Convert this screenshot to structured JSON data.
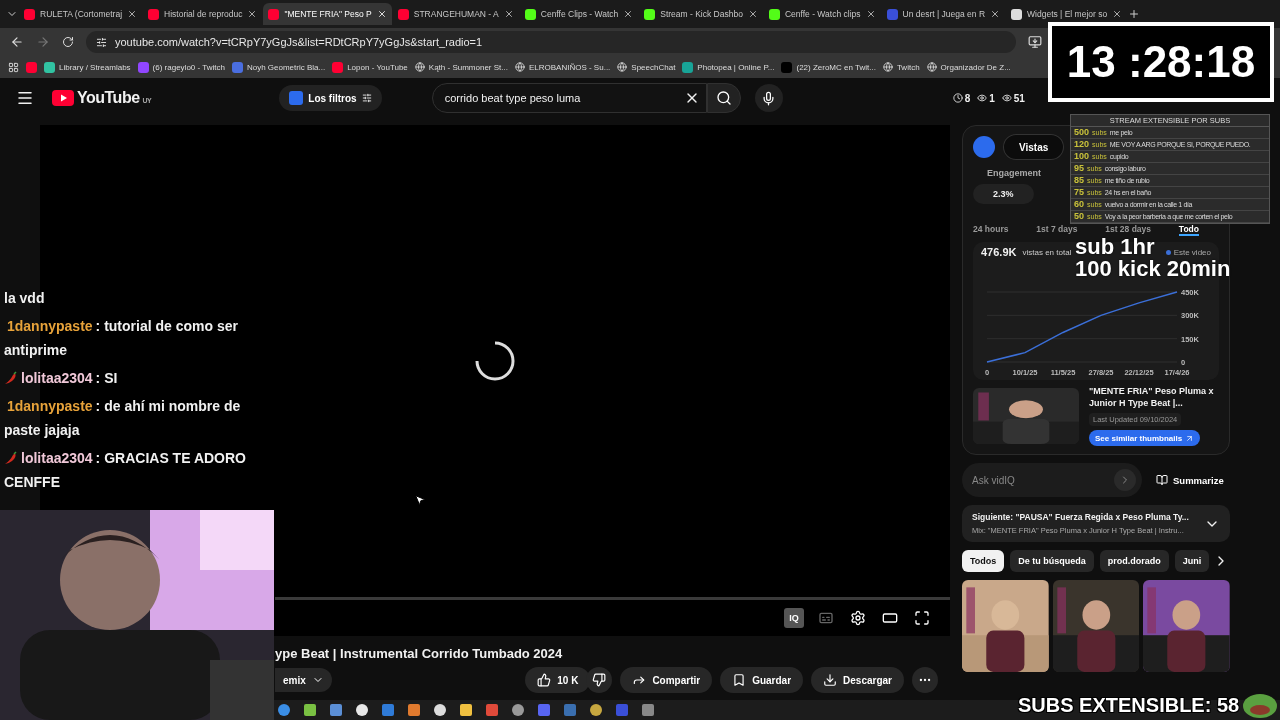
{
  "browser": {
    "tabs": [
      {
        "kind": "youtube",
        "title": "RULETA (Cortometraj",
        "selected": false
      },
      {
        "kind": "youtube",
        "title": "Historial de reproduc",
        "selected": false
      },
      {
        "kind": "youtube",
        "title": "\"MENTE FRIA\" Peso P",
        "selected": true
      },
      {
        "kind": "youtube",
        "title": "STRANGEHUMAN - A",
        "selected": false
      },
      {
        "kind": "kick",
        "title": "Cenffe Clips - Watch",
        "selected": false
      },
      {
        "kind": "kick",
        "title": "Stream - Kick Dashbo",
        "selected": false
      },
      {
        "kind": "kick",
        "title": "Cenffe - Watch clips",
        "selected": false
      },
      {
        "kind": "game",
        "title": "Un desrt | Juega en R",
        "selected": false
      },
      {
        "kind": "widget",
        "title": "Widgets | El mejor so",
        "selected": false
      }
    ],
    "url": "youtube.com/watch?v=tCRpY7yGgJs&list=RDtCRpY7yGgJs&start_radio=1",
    "bookmarks": [
      {
        "kind": "youtube"
      },
      {
        "kind": "streamlabs",
        "label": "Library / Streamlabs"
      },
      {
        "kind": "twitch",
        "label": "(6) rageylo0 - Twitch"
      },
      {
        "kind": "blue",
        "label": "Noyh Geometric Bla..."
      },
      {
        "kind": "youtube",
        "label": "Lopon - YouTube"
      },
      {
        "kind": "globe",
        "label": "Kąth - Summoner St..."
      },
      {
        "kind": "globe",
        "label": "ELROBANIÑOS - Su..."
      },
      {
        "kind": "globe",
        "label": "SpeechChat"
      },
      {
        "kind": "photopea",
        "label": "Photopea | Online P..."
      },
      {
        "kind": "x",
        "label": "(22) ZeroMC en Twit..."
      },
      {
        "kind": "globe",
        "label": "Twitch"
      },
      {
        "kind": "globe",
        "label": "Organizador De Z..."
      }
    ]
  },
  "header": {
    "logo": "YouTube",
    "region": "UY",
    "filter_chip": "Los filtros",
    "search": {
      "value": "corrido beat type peso luma"
    },
    "stats": [
      {
        "kind": "clock",
        "value": "8"
      },
      {
        "kind": "eye",
        "value": "1"
      },
      {
        "kind": "eye",
        "value": "51"
      }
    ]
  },
  "player": {
    "vidiq_button": "IQ"
  },
  "video": {
    "title": "ype Beat | Instrumental Corrido Tumbado 2024",
    "channel_chip": "emix",
    "likes": "10 K",
    "actions": [
      {
        "kind": "share",
        "label": "Compartir"
      },
      {
        "kind": "save",
        "label": "Guardar"
      },
      {
        "kind": "download",
        "label": "Descargar"
      }
    ]
  },
  "vidiq": {
    "tabs": [
      {
        "label": "Vistas",
        "selected": true
      }
    ],
    "metrics": [
      {
        "label": "Engagement",
        "value": "2.3%"
      }
    ],
    "periods": [
      {
        "label": "24 hours",
        "selected": false
      },
      {
        "label": "1st 7 days",
        "selected": false
      },
      {
        "label": "1st 28 days",
        "selected": false
      },
      {
        "label": "Todo",
        "selected": true
      }
    ],
    "total": "476.9K",
    "total_label": "vistas en total",
    "chart_data": {
      "type": "line",
      "categories": [
        "0",
        "10/1/25",
        "11/5/25",
        "27/8/25",
        "22/12/25",
        "17/4/26"
      ],
      "grid": true,
      "series": [
        {
          "name": "Este video",
          "color": "#3b6fd8",
          "values": [
            0,
            60000,
            190000,
            300000,
            380000,
            450000
          ]
        }
      ],
      "ylim": [
        0,
        450000
      ],
      "yticks": [
        {
          "value": 0,
          "label": "0"
        },
        {
          "value": 150000,
          "label": "150K"
        },
        {
          "value": 300000,
          "label": "300K"
        },
        {
          "value": 450000,
          "label": "450K"
        }
      ]
    },
    "video_card": {
      "title": "\"MENTE FRIA\" Peso Pluma x Junior H Type Beat |...",
      "updated": "Last Updated 09/10/2024",
      "button": "See similar thumbnails"
    },
    "ask": {
      "placeholder": "Ask vidIQ",
      "button": "Summarize"
    }
  },
  "up_next": {
    "title": "Siguiente: \"PAUSA\" Fuerza Regida x Peso Pluma Ty...",
    "subtitle": "Mix: \"MENTE FRIA\" Peso Pluma x Junior H Type Beat | Instru..."
  },
  "chips": [
    {
      "label": "Todos",
      "selected": true
    },
    {
      "label": "De tu búsqueda",
      "selected": false
    },
    {
      "label": "prod.dorado",
      "selected": false
    },
    {
      "label": "Juni",
      "selected": false
    }
  ],
  "overlay": {
    "clock": "13 :28:18",
    "goals_title": "STREAM EXTENSIBLE POR SUBS",
    "goals": [
      {
        "amount": "500",
        "unit": "subs",
        "text": "me pelo"
      },
      {
        "amount": "120",
        "unit": "subs",
        "text": "ME VOY A ARG PORQUE SI, PORQUE PUEDO."
      },
      {
        "amount": "100",
        "unit": "subs",
        "text": "cupido"
      },
      {
        "amount": "95",
        "unit": "subs",
        "text": "consigo laburo"
      },
      {
        "amount": "85",
        "unit": "subs",
        "text": "me tiño de rubio"
      },
      {
        "amount": "75",
        "unit": "subs",
        "text": "24 hs en el baño"
      },
      {
        "amount": "60",
        "unit": "subs",
        "text": "vuelvo a dormir en la calle 1 día"
      },
      {
        "amount": "50",
        "unit": "subs",
        "text": "Voy a la peor barberia a que me corten el pelo"
      }
    ],
    "notes": [
      "sub 1hr",
      "100 kick 20min"
    ],
    "chat": [
      {
        "text": "la vdd"
      },
      {
        "user": "1dannypaste",
        "color": "#e8a33a",
        "badge": false,
        "separator": ":",
        "text": "tutorial de como ser antiprime"
      },
      {
        "user": "lolitaa2304",
        "color": "#f0c8d8",
        "badge": true,
        "separator": ":",
        "text": "SI"
      },
      {
        "user": "1dannypaste",
        "color": "#e8a33a",
        "badge": false,
        "separator": ":",
        "text": "de ahí mi nombre de paste jajaja"
      },
      {
        "user": "lolitaa2304",
        "color": "#f0c8d8",
        "badge": true,
        "separator": ":",
        "text": "GRACIAS TE ADORO CENFFE"
      }
    ],
    "counter": "SUBS EXTENSIBLE: 58"
  }
}
